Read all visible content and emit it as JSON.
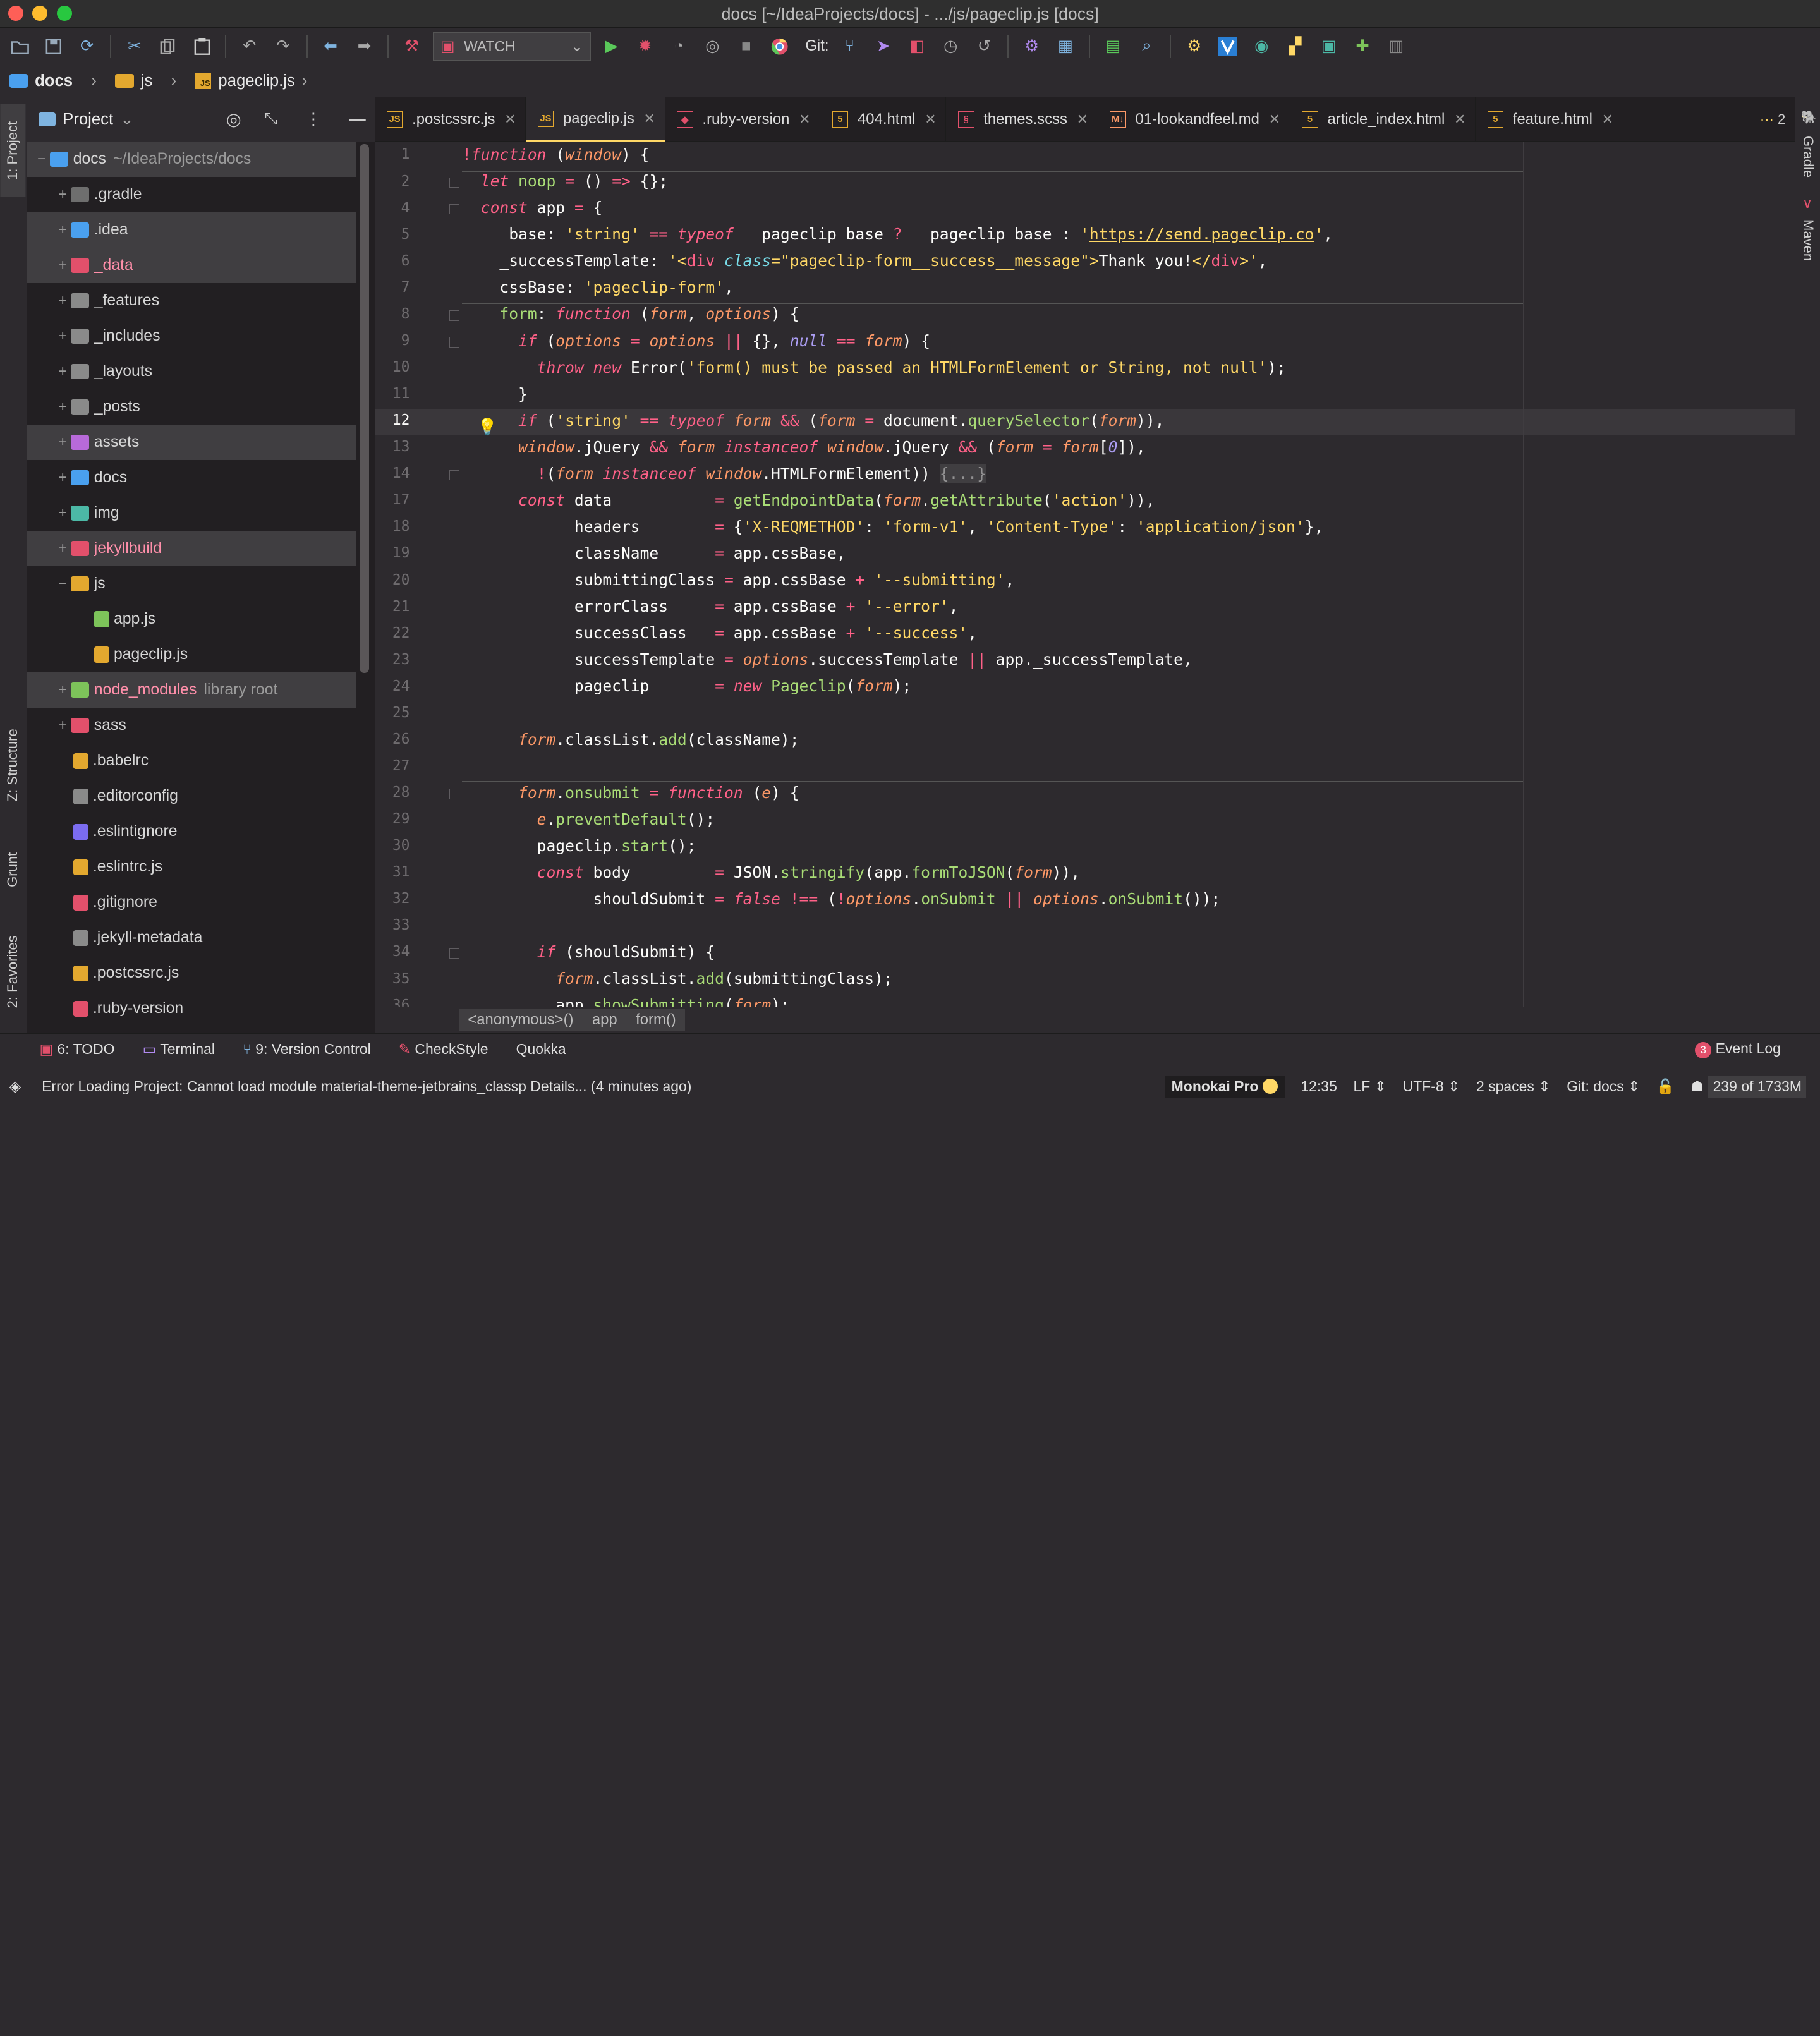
{
  "window": {
    "title": "docs [~/IdeaProjects/docs] - .../js/pageclip.js [docs]"
  },
  "toolbar": {
    "run_config": "WATCH",
    "git_label": "Git:"
  },
  "navbar": {
    "crumbs": [
      "docs",
      "js",
      "pageclip.js"
    ]
  },
  "left_tabs": {
    "project": "1: Project",
    "structure": "Z: Structure",
    "grunt": "Grunt",
    "favorites": "2: Favorites"
  },
  "right_tabs": {
    "gradle": "Gradle",
    "maven": "Maven"
  },
  "project_panel": {
    "title": "Project",
    "items": [
      {
        "label": "docs",
        "suffix": "~/IdeaProjects/docs",
        "toggle": "−",
        "icon": "#4aa0ef"
      },
      {
        "label": ".gradle",
        "toggle": "+",
        "icon": "#6e6e6e"
      },
      {
        "label": ".idea",
        "toggle": "+",
        "icon": "#4aa0ef"
      },
      {
        "label": "_data",
        "toggle": "+",
        "icon": "#e2506b"
      },
      {
        "label": "_features",
        "toggle": "+",
        "icon": "#8a8a8a"
      },
      {
        "label": "_includes",
        "toggle": "+",
        "icon": "#8a8a8a"
      },
      {
        "label": "_layouts",
        "toggle": "+",
        "icon": "#8a8a8a"
      },
      {
        "label": "_posts",
        "toggle": "+",
        "icon": "#8a8a8a"
      },
      {
        "label": "assets",
        "toggle": "+",
        "icon": "#b86ad9"
      },
      {
        "label": "docs",
        "toggle": "+",
        "icon": "#4aa0ef"
      },
      {
        "label": "img",
        "toggle": "+",
        "icon": "#4cb8a6"
      },
      {
        "label": "jekyllbuild",
        "toggle": "+",
        "icon": "#e2506b"
      },
      {
        "label": "js",
        "toggle": "−",
        "icon": "#e3a82f"
      },
      {
        "label": "app.js",
        "toggle": "",
        "icon": "#7dc35a"
      },
      {
        "label": "pageclip.js",
        "toggle": "",
        "icon": "#e3a82f"
      },
      {
        "label": "node_modules",
        "suffix": "library root",
        "toggle": "+",
        "icon": "#7dc35a"
      },
      {
        "label": "sass",
        "toggle": "+",
        "icon": "#e2506b"
      },
      {
        "label": ".babelrc",
        "toggle": "",
        "icon": "#e3a82f"
      },
      {
        "label": ".editorconfig",
        "toggle": "",
        "icon": "#8a8a8a"
      },
      {
        "label": ".eslintignore",
        "toggle": "",
        "icon": "#7b6cf0"
      },
      {
        "label": ".eslintrc.js",
        "toggle": "",
        "icon": "#e3a82f"
      },
      {
        "label": ".gitignore",
        "toggle": "",
        "icon": "#e2506b"
      },
      {
        "label": ".jekyll-metadata",
        "toggle": "",
        "icon": "#8a8a8a"
      },
      {
        "label": ".postcssrc.js",
        "toggle": "",
        "icon": "#e3a82f"
      },
      {
        "label": ".ruby-version",
        "toggle": "",
        "icon": "#e2506b"
      }
    ]
  },
  "editor_tabs": [
    {
      "label": ".postcssrc.js",
      "icon": "JS",
      "color": "#e3a82f"
    },
    {
      "label": "pageclip.js",
      "icon": "JS",
      "color": "#e3a82f"
    },
    {
      "label": ".ruby-version",
      "icon": "◆",
      "color": "#e2506b"
    },
    {
      "label": "404.html",
      "icon": "5",
      "color": "#e3a82f"
    },
    {
      "label": "themes.scss",
      "icon": "§",
      "color": "#e2506b"
    },
    {
      "label": "01-lookandfeel.md",
      "icon": "M↓",
      "color": "#fc9867"
    },
    {
      "label": "article_index.html",
      "icon": "5",
      "color": "#e3a82f"
    },
    {
      "label": "feature.html",
      "icon": "5",
      "color": "#e3a82f"
    }
  ],
  "tab_overflow": "2",
  "gutter_numbers": [
    "1",
    "2",
    "4",
    "5",
    "6",
    "7",
    "8",
    "9",
    "10",
    "11",
    "12",
    "13",
    "14",
    "17",
    "18",
    "19",
    "20",
    "21",
    "22",
    "23",
    "24",
    "25",
    "26",
    "27",
    "28",
    "29",
    "30",
    "31",
    "32",
    "33",
    "34",
    "35",
    "36"
  ],
  "breadcrumbs": [
    "<anonymous>()",
    "app",
    "form()"
  ],
  "bottom_tools": {
    "todo": "6: TODO",
    "terminal": "Terminal",
    "vcs": "9: Version Control",
    "checkstyle": "CheckStyle",
    "quokka": "Quokka",
    "event_log": "Event Log",
    "event_count": "3"
  },
  "status": {
    "message": "Error Loading Project: Cannot load module material-theme-jetbrains_classp Details... (4 minutes ago)",
    "theme": "Monokai Pro",
    "position": "12:35",
    "line_sep": "LF",
    "encoding": "UTF-8",
    "indent": "2 spaces",
    "git": "Git: docs",
    "memory": "239 of 1733M"
  }
}
